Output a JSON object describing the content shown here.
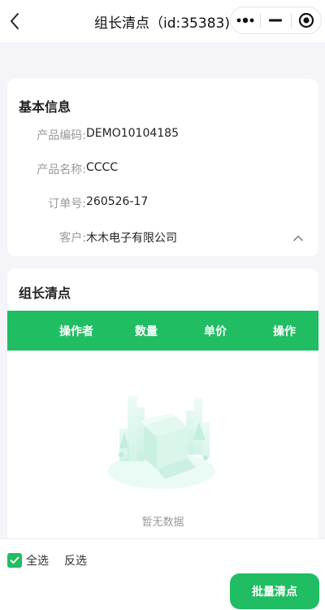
{
  "navbar": {
    "title": "组长清点（id:35383)",
    "back_icon": "chevron-left-icon",
    "capsule": {
      "more_icon": "more-dots-icon",
      "minimize_icon": "minimize-icon",
      "close_icon": "target-circle-icon"
    }
  },
  "basic_info": {
    "title": "基本信息",
    "rows": [
      {
        "label": "产品编码:",
        "value": "DEMO10104185"
      },
      {
        "label": "产品名称:",
        "value": "CCCC"
      },
      {
        "label": "订单号:",
        "value": "260526-17"
      },
      {
        "label": "客户:",
        "value": "木木电子有限公司"
      }
    ],
    "collapse_icon": "chevron-up-icon"
  },
  "count_section": {
    "title": "组长清点",
    "columns": [
      "操作者",
      "数量",
      "单价",
      "操作"
    ],
    "empty_text": "暂无数据"
  },
  "bottom_bar": {
    "select_all_label": "全选",
    "select_all_checked": true,
    "invert_label": "反选",
    "batch_button_label": "批量清点"
  },
  "colors": {
    "accent": "#20bd62",
    "background": "#f5f4f9",
    "label_gray": "#999999"
  }
}
